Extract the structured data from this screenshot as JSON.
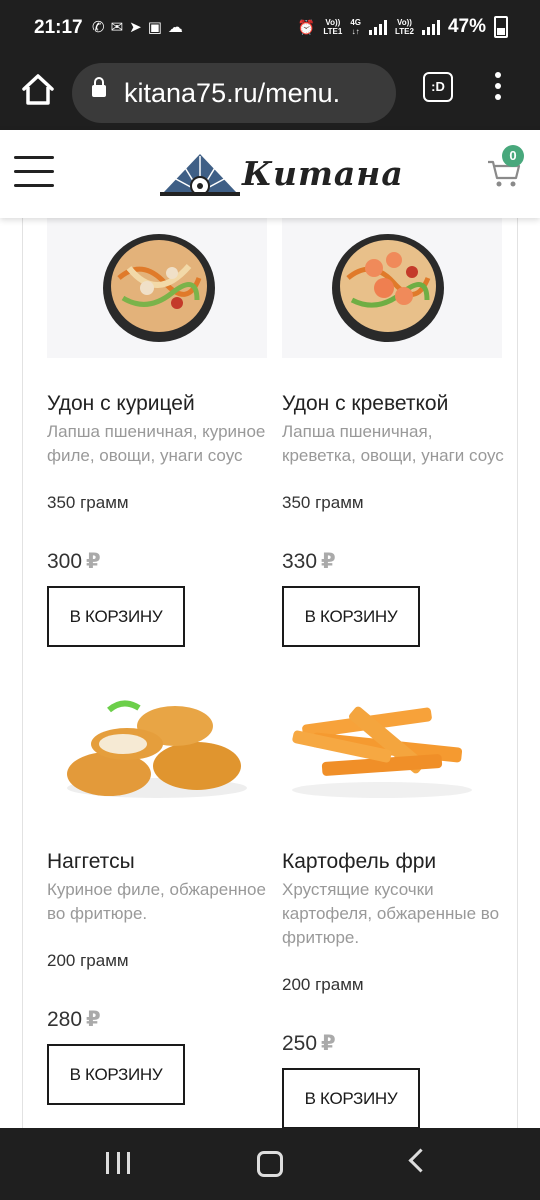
{
  "status_bar": {
    "time": "21:17",
    "sim1_label_top": "Vo))",
    "sim1_label_bottom": "LTE1",
    "net_label_top": "4G",
    "sim2_label_top": "Vo))",
    "sim2_label_bottom": "LTE2",
    "battery_percent": "47%"
  },
  "browser": {
    "url": "kitana75.ru/menu.",
    "tabs_label": ":D"
  },
  "site": {
    "logo_text": "Китана",
    "cart_count": "0"
  },
  "products": [
    {
      "name": "Удон с курицей",
      "description": "Лапша пшеничная, куриное филе, овощи, унаги соус",
      "weight": "350 грамм",
      "price": "300",
      "currency": "₽",
      "button": "В КОРЗИНУ"
    },
    {
      "name": "Удон с креветкой",
      "description": "Лапша пшеничная, креветка, овощи, унаги соус",
      "weight": "350 грамм",
      "price": "330",
      "currency": "₽",
      "button": "В КОРЗИНУ"
    },
    {
      "name": "Наггетсы",
      "description": "Куриное филе, обжаренное во фритюре.",
      "weight": "200 грамм",
      "price": "280",
      "currency": "₽",
      "button": "В КОРЗИНУ"
    },
    {
      "name": "Картофель фри",
      "description": "Хрустящие кусочки картофеля, обжаренные во фритюре.",
      "weight": "200 грамм",
      "price": "250",
      "currency": "₽",
      "button": "В КОРЗИНУ"
    }
  ],
  "colors": {
    "system_bar": "#1f1f1f",
    "url_box": "#3a3a3a",
    "badge_green": "#48a87c",
    "logo_blue": "#3f5f86"
  }
}
